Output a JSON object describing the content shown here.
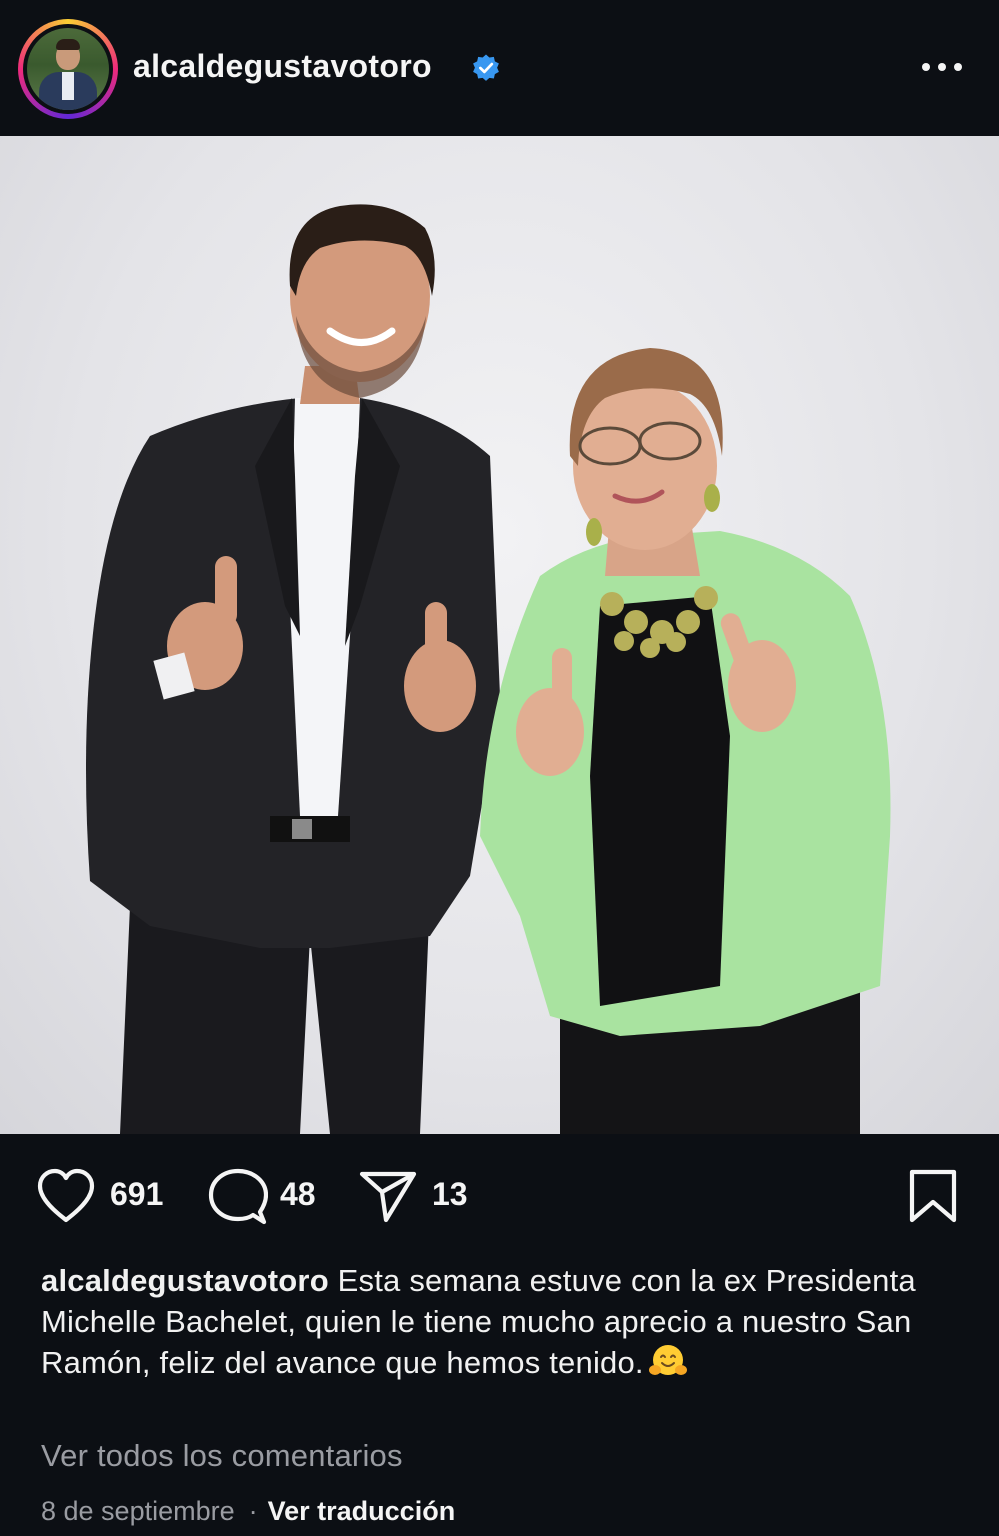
{
  "header": {
    "username": "alcaldegustavotoro",
    "verified": true,
    "more_icon": "more-horizontal-icon",
    "avatar_icon": "avatar"
  },
  "post": {
    "photo_alt": "photo",
    "colors": {
      "background": "#0c0f14",
      "text": "#f5f5f5",
      "muted": "#9a9ca2",
      "verified_blue": "#3897f0",
      "jacket_green": "#a9e3a0",
      "suit_dark": "#1e1e22"
    }
  },
  "actions": {
    "like_icon": "heart-icon",
    "like_count": "691",
    "comment_icon": "comment-bubble-icon",
    "comment_count": "48",
    "share_icon": "paper-plane-icon",
    "share_count": "13",
    "save_icon": "bookmark-icon"
  },
  "caption": {
    "username": "alcaldegustavotoro",
    "text": "Esta semana estuve con la ex Presidenta Michelle Bachelet, quien le tiene mucho aprecio a nuestro San Ramón, feliz del avance que hemos tenido.",
    "emoji": "hugging-face-emoji"
  },
  "view_comments": "Ver todos los comentarios",
  "meta": {
    "date": "8 de septiembre",
    "separator": "·",
    "translate": "Ver traducción"
  }
}
